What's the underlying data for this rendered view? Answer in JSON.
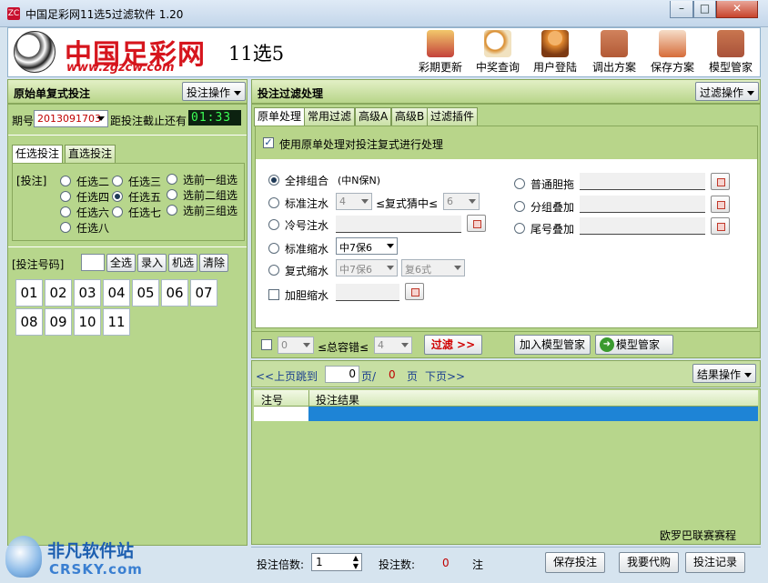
{
  "window": {
    "title": "中国足彩网11选5过滤软件 1.20",
    "app_icon": "ZC"
  },
  "header": {
    "logo_text": "中国足彩网",
    "logo_url": "www.zgzcw.com",
    "product": "11选5",
    "tools": [
      {
        "label": "彩期更新",
        "icon": "package-icon",
        "color": "#c4423b"
      },
      {
        "label": "中奖查询",
        "icon": "magnifier-icon",
        "color": "#d98b2b"
      },
      {
        "label": "用户登陆",
        "icon": "user-icon",
        "color": "#e38a2f"
      },
      {
        "label": "调出方案",
        "icon": "house-open-icon",
        "color": "#b35a36"
      },
      {
        "label": "保存方案",
        "icon": "save-doc-icon",
        "color": "#d66c3a"
      },
      {
        "label": "模型管家",
        "icon": "house-model-icon",
        "color": "#a9523a"
      }
    ]
  },
  "left": {
    "title": "原始单复式投注",
    "menu_btn": "投注操作",
    "issue_label": "期号",
    "issue_value": "2013091703",
    "deadline_label": "距投注截止还有",
    "led": "01:33",
    "tabs": [
      "任选投注",
      "直选投注"
    ],
    "bet_label": "[投注]",
    "bet_options": [
      "任选二",
      "任选三",
      "选前一组选",
      "任选四",
      "任选五",
      "选前二组选",
      "任选六",
      "任选七",
      "选前三组选",
      "任选八"
    ],
    "numbers_label": "[投注号码]",
    "num_buttons": [
      "全选",
      "录入",
      "机选",
      "清除"
    ],
    "numbers": [
      "01",
      "02",
      "03",
      "04",
      "05",
      "06",
      "07",
      "08",
      "09",
      "10",
      "11"
    ]
  },
  "right": {
    "title": "投注过滤处理",
    "menu_btn": "过滤操作",
    "tabs": [
      "原单处理",
      "常用过滤",
      "高级A",
      "高级B",
      "过滤插件"
    ],
    "use_original": "使用原单处理对投注复式进行处理",
    "options": {
      "full": "全排组合",
      "full_note": "(中N保N)",
      "standard_water": "标准注水",
      "standard_water_sel": "4",
      "complex_hit": "≤复式猜中≤",
      "complex_hit_sel": "6",
      "cold_water": "冷号注水",
      "standard_shrink": "标准缩水",
      "standard_shrink_sel": "中7保6",
      "complex_shrink": "复式缩水",
      "complex_shrink_sel1": "中7保6",
      "complex_shrink_sel2": "复6式",
      "gallbladder_shrink": "加胆缩水",
      "normal_drag": "普通胆拖",
      "group_add": "分组叠加",
      "tail_add": "尾号叠加"
    },
    "filter_row": {
      "sel1": "0",
      "total_err": "≤总容错≤",
      "sel2": "4",
      "filter_btn": "过滤 >>",
      "add_model": "加入模型管家",
      "model": "模型管家"
    },
    "pager": {
      "prev": "<<上页",
      "jump": "跳到",
      "page": "0",
      "page_unit": "页/",
      "total": "0",
      "total_unit": "页",
      "next": "下页>>",
      "result_btn": "结果操作"
    },
    "table": {
      "headers": [
        "注号",
        "投注结果"
      ]
    },
    "footer_label": "欧罗巴联赛赛程"
  },
  "statusbar": {
    "multiple_label": "投注倍数:",
    "multiple": "1",
    "count_label": "投注数:",
    "count": "0",
    "unit": "注",
    "save_btn": "保存投注",
    "buy_btn": "我要代购",
    "record_btn": "投注记录"
  },
  "watermark": {
    "text": "非凡软件站",
    "sub": "CRSKY.com"
  }
}
